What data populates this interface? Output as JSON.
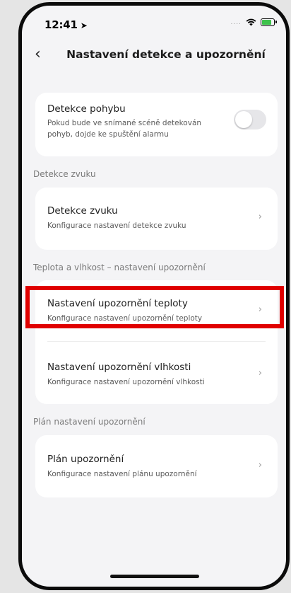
{
  "status_bar": {
    "time": "12:41",
    "location_icon": "location-arrow-icon",
    "signal": "....",
    "wifi_icon": "wifi-icon",
    "battery_icon": "battery-charging-icon"
  },
  "header": {
    "back_icon": "chevron-left-icon",
    "title": "Nastavení detekce a upozornění"
  },
  "motion": {
    "title": "Detekce pohybu",
    "description_line1": "Pokud bude ve snímané scéně detekován",
    "description_line2": "pohyb, dojde ke spuštění alarmu",
    "toggle_on": false
  },
  "sections": {
    "sound_label": "Detekce zvuku",
    "temp_humidity_label": "Teplota a vlhkost – nastavení upozornění",
    "schedule_label": "Plán nastavení upozornění"
  },
  "items": {
    "sound": {
      "title": "Detekce zvuku",
      "subtitle": "Konfigurace nastavení detekce zvuku"
    },
    "temperature": {
      "title": "Nastavení upozornění teploty",
      "subtitle": "Konfigurace nastavení upozornění teploty"
    },
    "humidity": {
      "title": "Nastavení upozornění vlhkosti",
      "subtitle": "Konfigurace nastavení upozornění vlhkosti"
    },
    "schedule": {
      "title": "Plán upozornění",
      "subtitle": "Konfigurace nastavení plánu upozornění"
    }
  },
  "chevron_glyph": "›",
  "colors": {
    "highlight": "#e00000",
    "background": "#f4f4f6",
    "card": "#ffffff",
    "battery_fill": "#3ec24b"
  }
}
